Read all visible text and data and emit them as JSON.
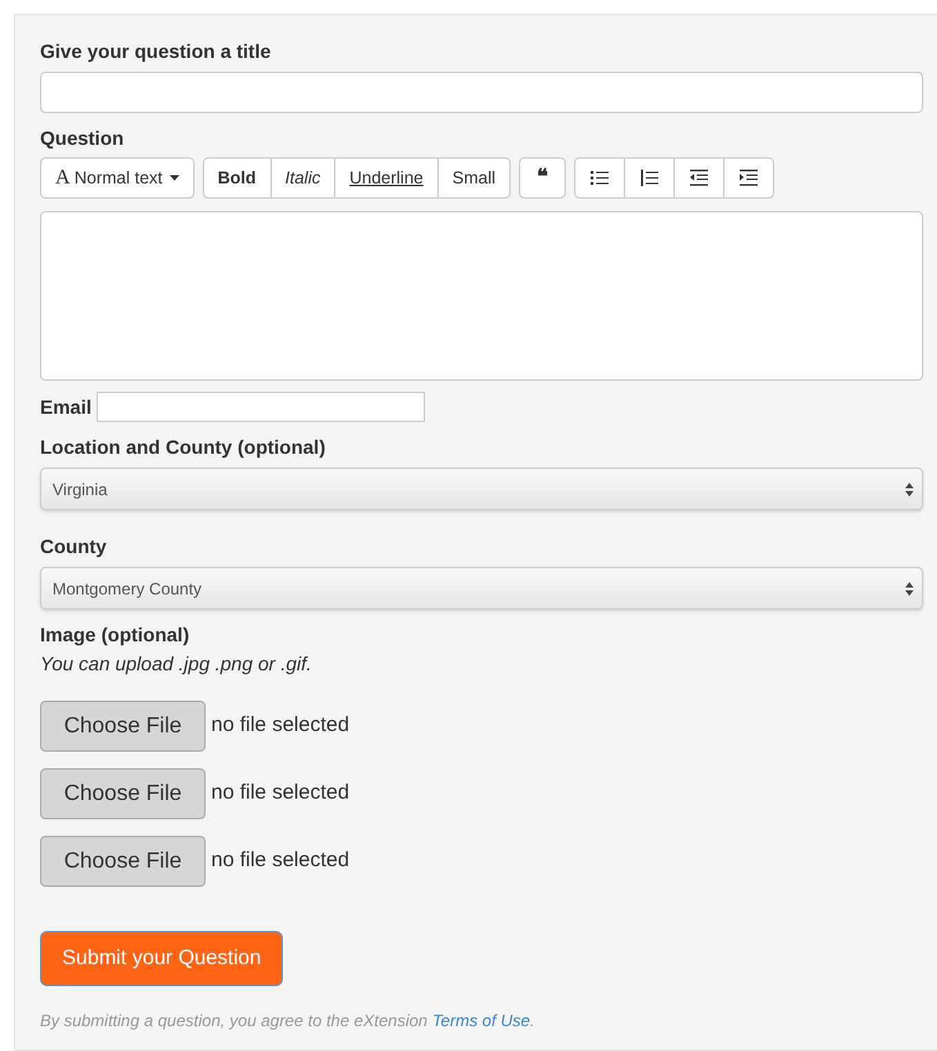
{
  "title_field": {
    "label": "Give your question a title"
  },
  "question": {
    "label": "Question",
    "toolbar": [
      [
        {
          "kind": "dropdown",
          "glyph": "A",
          "label": "Normal text"
        }
      ],
      [
        {
          "kind": "bold",
          "label": "Bold"
        },
        {
          "kind": "italic",
          "label": "Italic"
        },
        {
          "kind": "underline",
          "label": "Underline"
        },
        {
          "kind": "small",
          "label": "Small"
        }
      ],
      [
        {
          "kind": "quote",
          "glyph": "❝"
        }
      ],
      [
        {
          "kind": "bullet-list"
        },
        {
          "kind": "numbered-list"
        },
        {
          "kind": "outdent"
        },
        {
          "kind": "indent"
        }
      ]
    ]
  },
  "email": {
    "label": "Email"
  },
  "location": {
    "label": "Location and County (optional)",
    "value": "Virginia"
  },
  "county": {
    "label": "County",
    "value": "Montgomery County"
  },
  "image": {
    "label": "Image (optional)",
    "hint": "You can upload .jpg .png or .gif.",
    "files": [
      {
        "button": "Choose File",
        "status": "no file selected"
      },
      {
        "button": "Choose File",
        "status": "no file selected"
      },
      {
        "button": "Choose File",
        "status": "no file selected"
      }
    ]
  },
  "submit": "Submit your Question",
  "footer": {
    "text": "By submitting a question, you agree to the eXtension",
    "link": "Terms of Use",
    "end": "."
  }
}
